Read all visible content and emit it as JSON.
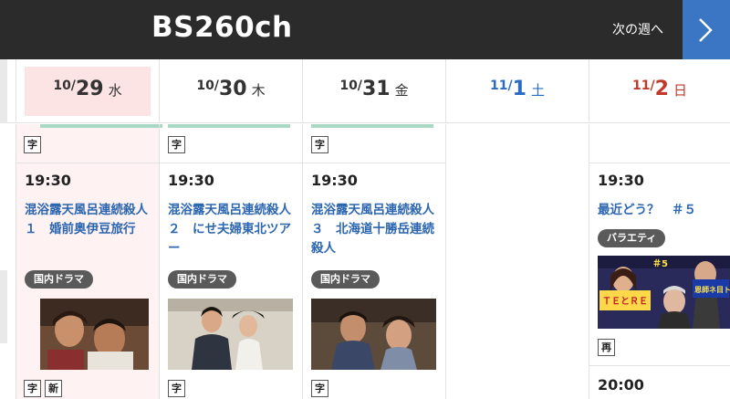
{
  "header": {
    "channel": "BS260ch",
    "next_week_label": "次の週へ"
  },
  "dates": [
    {
      "month": "10/",
      "day": "29",
      "weekday": "水",
      "color": "#333333",
      "today": true
    },
    {
      "month": "10/",
      "day": "30",
      "weekday": "木",
      "color": "#333333",
      "today": false
    },
    {
      "month": "10/",
      "day": "31",
      "weekday": "金",
      "color": "#333333",
      "today": false
    },
    {
      "month": "11/",
      "day": "1",
      "weekday": "土",
      "color": "#2a6cc4",
      "today": false
    },
    {
      "month": "11/",
      "day": "2",
      "weekday": "日",
      "color": "#c0392b",
      "today": false
    }
  ],
  "columns": [
    {
      "top_caption": "字",
      "program": {
        "time": "19:30",
        "title": "混浴露天風呂連続殺人１　婚前奥伊豆旅行",
        "genre": "国内ドラマ",
        "captions": [
          "字",
          "新"
        ]
      }
    },
    {
      "top_caption": "字",
      "program": {
        "time": "19:30",
        "title": "混浴露天風呂連続殺人２　にせ夫婦東北ツアー",
        "genre": "国内ドラマ",
        "captions": [
          "字"
        ]
      }
    },
    {
      "top_caption": "字",
      "program": {
        "time": "19:30",
        "title": "混浴露天風呂連続殺人３　北海道十勝岳連続殺人",
        "genre": "国内ドラマ",
        "captions": [
          "字"
        ]
      }
    },
    {
      "top_caption": "",
      "program": null
    },
    {
      "top_caption": "",
      "program": {
        "time": "19:30",
        "title": "最近どう？　＃５",
        "genre": "バラエティ",
        "captions": [
          "再"
        ],
        "thumb_text": {
          "badge": "＃5",
          "left": "ＴＥとＲＥ",
          "right": "恩師ネ目トーク"
        }
      },
      "next_time": "20:00"
    }
  ],
  "colors": {
    "header_bg": "#2b2b2b",
    "next_btn_bg": "#3a76c4",
    "title_link": "#2c66b0",
    "today_bg": "#fff2f2",
    "genre_bg": "#5a5a5a"
  }
}
